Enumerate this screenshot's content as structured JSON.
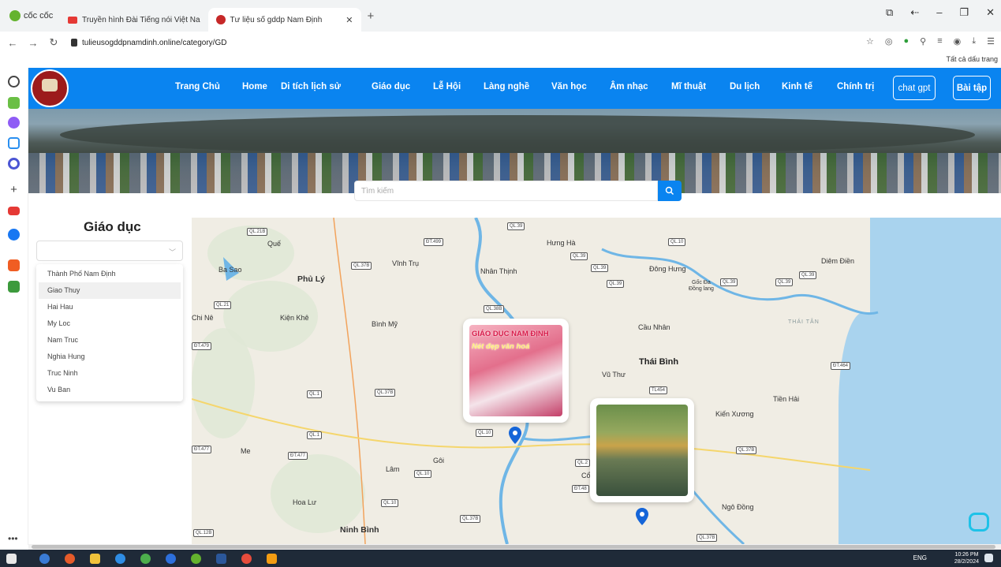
{
  "browser": {
    "brand": "cốc cốc",
    "tabs": [
      {
        "title": "Truyền hình Đài Tiếng nói Việt Na"
      },
      {
        "title": "Tư liệu số gddp Nam Định"
      }
    ],
    "url": "tulieusogddpnamdinh.online/category/GD",
    "bookmarks_all": "Tất cả dấu trang"
  },
  "site": {
    "menu": [
      "Trang Chủ",
      "Home",
      "Di tích lịch sử",
      "Giáo dục",
      "Lễ Hội",
      "Làng nghề",
      "Văn học",
      "Âm nhạc",
      "Mĩ thuật",
      "Du lịch",
      "Kinh tế",
      "Chính trị"
    ],
    "btn_chat": "chat gpt",
    "btn_baitap": "Bài tập",
    "search_placeholder": "Tìm kiếm"
  },
  "filter": {
    "title": "Giáo dục",
    "options": [
      "Thành Phố Nam Định",
      "Giao Thuy",
      "Hai Hau",
      "My Loc",
      "Nam Truc",
      "Nghia Hung",
      "Truc Ninh",
      "Vu Ban"
    ],
    "hovered_index": 1
  },
  "map": {
    "places": [
      {
        "name": "Quế"
      },
      {
        "name": "Hưng Hà"
      },
      {
        "name": "Vĩnh Trụ"
      },
      {
        "name": "Ba Sao"
      },
      {
        "name": "Phủ Lý"
      },
      {
        "name": "Nhân Thịnh"
      },
      {
        "name": "Đông Hưng"
      },
      {
        "name": "Gốc Đa"
      },
      {
        "name": "Đồng lang"
      },
      {
        "name": "Diêm Điền"
      },
      {
        "name": "Chi Nê"
      },
      {
        "name": "Kiện Khê"
      },
      {
        "name": "Bình Mỹ"
      },
      {
        "name": "Cầu Nhân"
      },
      {
        "name": "THÁI TÂN"
      },
      {
        "name": "Thái Bình"
      },
      {
        "name": "Vũ Thư"
      },
      {
        "name": "Tiền Hải"
      },
      {
        "name": "Kiến Xương"
      },
      {
        "name": "Me"
      },
      {
        "name": "Gôi"
      },
      {
        "name": "Lâm"
      },
      {
        "name": "Cổ"
      },
      {
        "name": "Hoa Lư"
      },
      {
        "name": "Ngô Đồng"
      },
      {
        "name": "Ninh Bình"
      }
    ],
    "roads": [
      "QL.21B",
      "QL.39",
      "ĐT.499",
      "QL.10",
      "QL.39",
      "QL.37B",
      "QL.39",
      "QL.39",
      "QL.39",
      "QL.39",
      "QL.39",
      "QL.38B",
      "QL.21",
      "ĐT.479",
      "ĐT.464",
      "TL454",
      "QL.1",
      "QL.37B",
      "QL.1",
      "ĐT.477",
      "ĐT.477",
      "QL.10",
      "QL.10",
      "QL.37B",
      "QL.10",
      "QL.37B",
      "QL.12B",
      "QL.37B",
      "QL.2",
      "ĐT.48"
    ],
    "card1_title_1": "GIÁO DỤC NAM ĐỊNH",
    "card1_title_2": "Nét đẹp văn hoá"
  },
  "taskbar": {
    "lang": "ENG",
    "time": "10:26 PM",
    "date": "28/2/2024"
  },
  "colors": {
    "nav_blue": "#0a84f0",
    "sea": "#a9d3ee",
    "pin": "#1565d8"
  }
}
